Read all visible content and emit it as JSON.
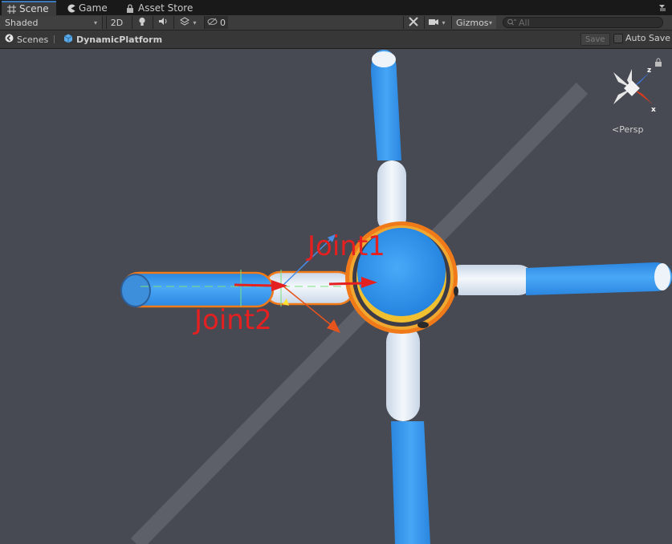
{
  "tabs": [
    {
      "label": "Scene",
      "icon": "grid-icon",
      "active": true
    },
    {
      "label": "Game",
      "icon": "pacman-icon",
      "active": false
    },
    {
      "label": "Asset Store",
      "icon": "lock-icon",
      "active": false
    }
  ],
  "toolbar": {
    "shading_mode": "Shaded",
    "mode_2d": "2D",
    "hidden_count": "0",
    "gizmos_label": "Gizmos",
    "search_placeholder": "All"
  },
  "breadcrumb": {
    "scenes_label": "Scenes",
    "current_prefab": "DynamicPlatform",
    "save_label": "Save",
    "autosave_label": "Auto Save"
  },
  "scene_gizmo": {
    "projection_label": "Persp",
    "axes": {
      "z": "z",
      "x": "x"
    }
  },
  "annotations": {
    "joint1": "Joint1",
    "joint2": "Joint2"
  },
  "colors": {
    "accent": "#3a79bb",
    "annotation_red": "#e52020",
    "selection_orange": "#f07a1a",
    "capsule_blue": "#2f8fe8"
  }
}
